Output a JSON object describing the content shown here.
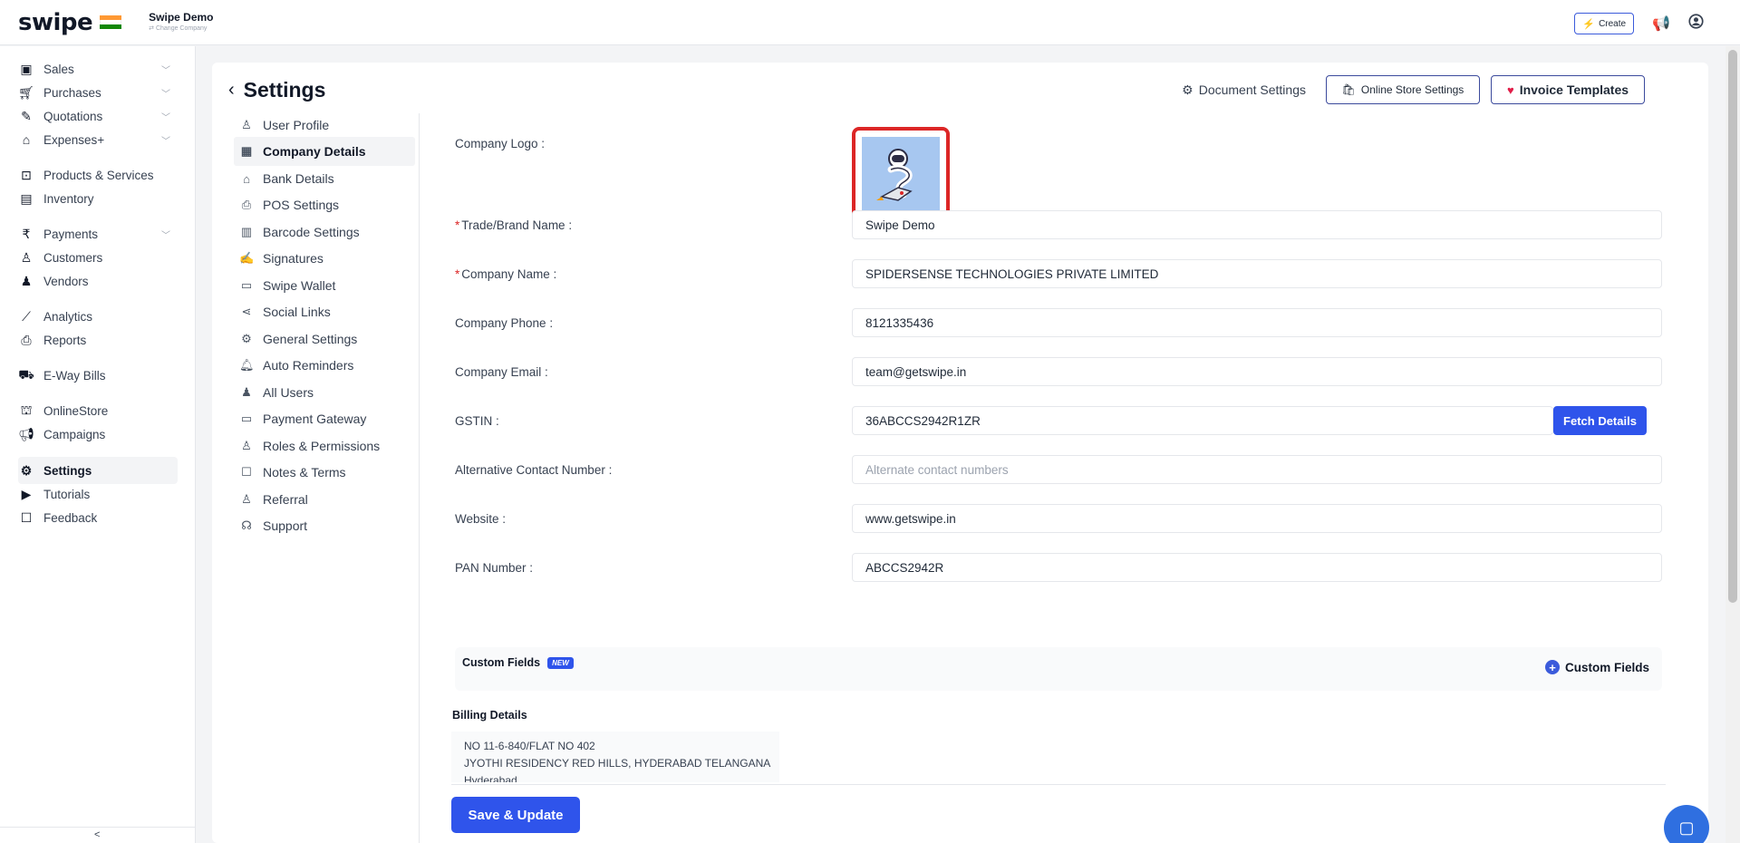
{
  "app": {
    "logo": "swipe",
    "company_name": "Swipe Demo",
    "change_company": "⇄ Change Company",
    "create_label": "Create"
  },
  "sidebar": {
    "items": [
      {
        "label": "Sales",
        "icon": "cash-icon"
      },
      {
        "label": "Purchases",
        "icon": "cart-icon"
      },
      {
        "label": "Quotations",
        "icon": "pen-icon"
      },
      {
        "label": "Expenses+",
        "icon": "tag-icon"
      },
      {
        "label": "Products & Services",
        "icon": "box-icon"
      },
      {
        "label": "Inventory",
        "icon": "warehouse-icon"
      },
      {
        "label": "Payments",
        "icon": "rupee-icon"
      },
      {
        "label": "Customers",
        "icon": "user-icon"
      },
      {
        "label": "Vendors",
        "icon": "users-icon"
      },
      {
        "label": "Analytics",
        "icon": "chart-icon"
      },
      {
        "label": "Reports",
        "icon": "report-icon"
      },
      {
        "label": "E-Way Bills",
        "icon": "truck-icon"
      },
      {
        "label": "OnlineStore",
        "icon": "store-icon"
      },
      {
        "label": "Campaigns",
        "icon": "megaphone-icon"
      },
      {
        "label": "Settings",
        "icon": "gear-icon"
      },
      {
        "label": "Tutorials",
        "icon": "youtube-icon"
      },
      {
        "label": "Feedback",
        "icon": "message-icon"
      }
    ],
    "bottom_label": "<"
  },
  "page": {
    "title": "Settings",
    "document_settings": "Document Settings",
    "online_store_settings": "Online Store Settings",
    "invoice_templates": "Invoice Templates"
  },
  "settings_menu": [
    "User Profile",
    "Company Details",
    "Bank Details",
    "POS Settings",
    "Barcode Settings",
    "Signatures",
    "Swipe Wallet",
    "Social Links",
    "General Settings",
    "Auto Reminders",
    "All Users",
    "Payment Gateway",
    "Roles & Permissions",
    "Notes & Terms",
    "Referral",
    "Support"
  ],
  "form": {
    "company_logo_label": "Company Logo :",
    "trade_name_label": "Trade/Brand Name :",
    "trade_name_value": "Swipe Demo",
    "company_name_label": "Company Name :",
    "company_name_value": "SPIDERSENSE TECHNOLOGIES PRIVATE LIMITED",
    "phone_label": "Company Phone :",
    "phone_value": "8121335436",
    "email_label": "Company Email :",
    "email_value": "team@getswipe.in",
    "gstin_label": "GSTIN :",
    "gstin_value": "36ABCCS2942R1ZR",
    "fetch_details": "Fetch Details",
    "alt_contact_label": "Alternative Contact Number :",
    "alt_contact_placeholder": "Alternate contact numbers",
    "website_label": "Website :",
    "website_value": "www.getswipe.in",
    "pan_label": "PAN Number :",
    "pan_value": "ABCCS2942R"
  },
  "custom_fields": {
    "title": "Custom Fields",
    "badge": "NEW",
    "add_label": "Custom Fields"
  },
  "billing": {
    "title": "Billing Details",
    "lines": [
      "NO 11-6-840/FLAT NO 402",
      "JYOTHI RESIDENCY RED HILLS, HYDERABAD TELANGANA",
      "Hyderabad"
    ]
  },
  "save_button": "Save & Update"
}
